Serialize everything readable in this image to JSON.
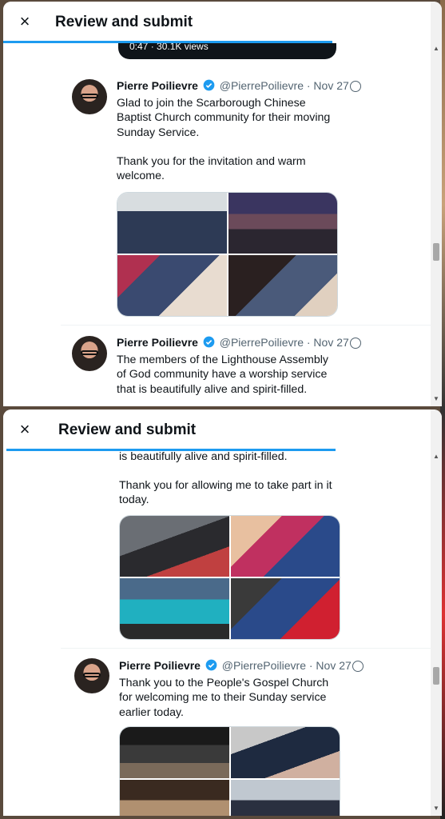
{
  "dialog": {
    "title": "Review and submit",
    "close_label": "×"
  },
  "panel1": {
    "prev_media_caption": "0:47 · 30.1K views",
    "tweet_a": {
      "name": "Pierre Poilievre",
      "handle": "@PierrePoilievre",
      "date": "· Nov 27",
      "text1": "Glad to join the Scarborough Chinese Baptist Church community for their moving Sunday Service.",
      "text2": "Thank you for the invitation and warm welcome."
    },
    "tweet_b": {
      "name": "Pierre Poilievre",
      "handle": "@PierrePoilievre",
      "date": "· Nov 27",
      "text1": "The members of the Lighthouse Assembly of God community have a worship service that is beautifully alive and spirit-filled."
    }
  },
  "panel2": {
    "tweet_b_cont": {
      "text_tail": "is beautifully alive and spirit-filled.",
      "text2": "Thank you for allowing me to take part in it today."
    },
    "tweet_c": {
      "name": "Pierre Poilievre",
      "handle": "@PierrePoilievre",
      "date": "· Nov 27",
      "text1": "Thank you to the People's Gospel Church for welcoming me to their Sunday service earlier today."
    }
  },
  "colors": {
    "accent": "#1d9bf0",
    "text": "#0f1419",
    "muted": "#536471"
  },
  "icons": [
    "close-icon",
    "verified-badge-icon",
    "radio-unselected-icon",
    "scroll-up-arrow-icon",
    "scroll-down-arrow-icon"
  ]
}
